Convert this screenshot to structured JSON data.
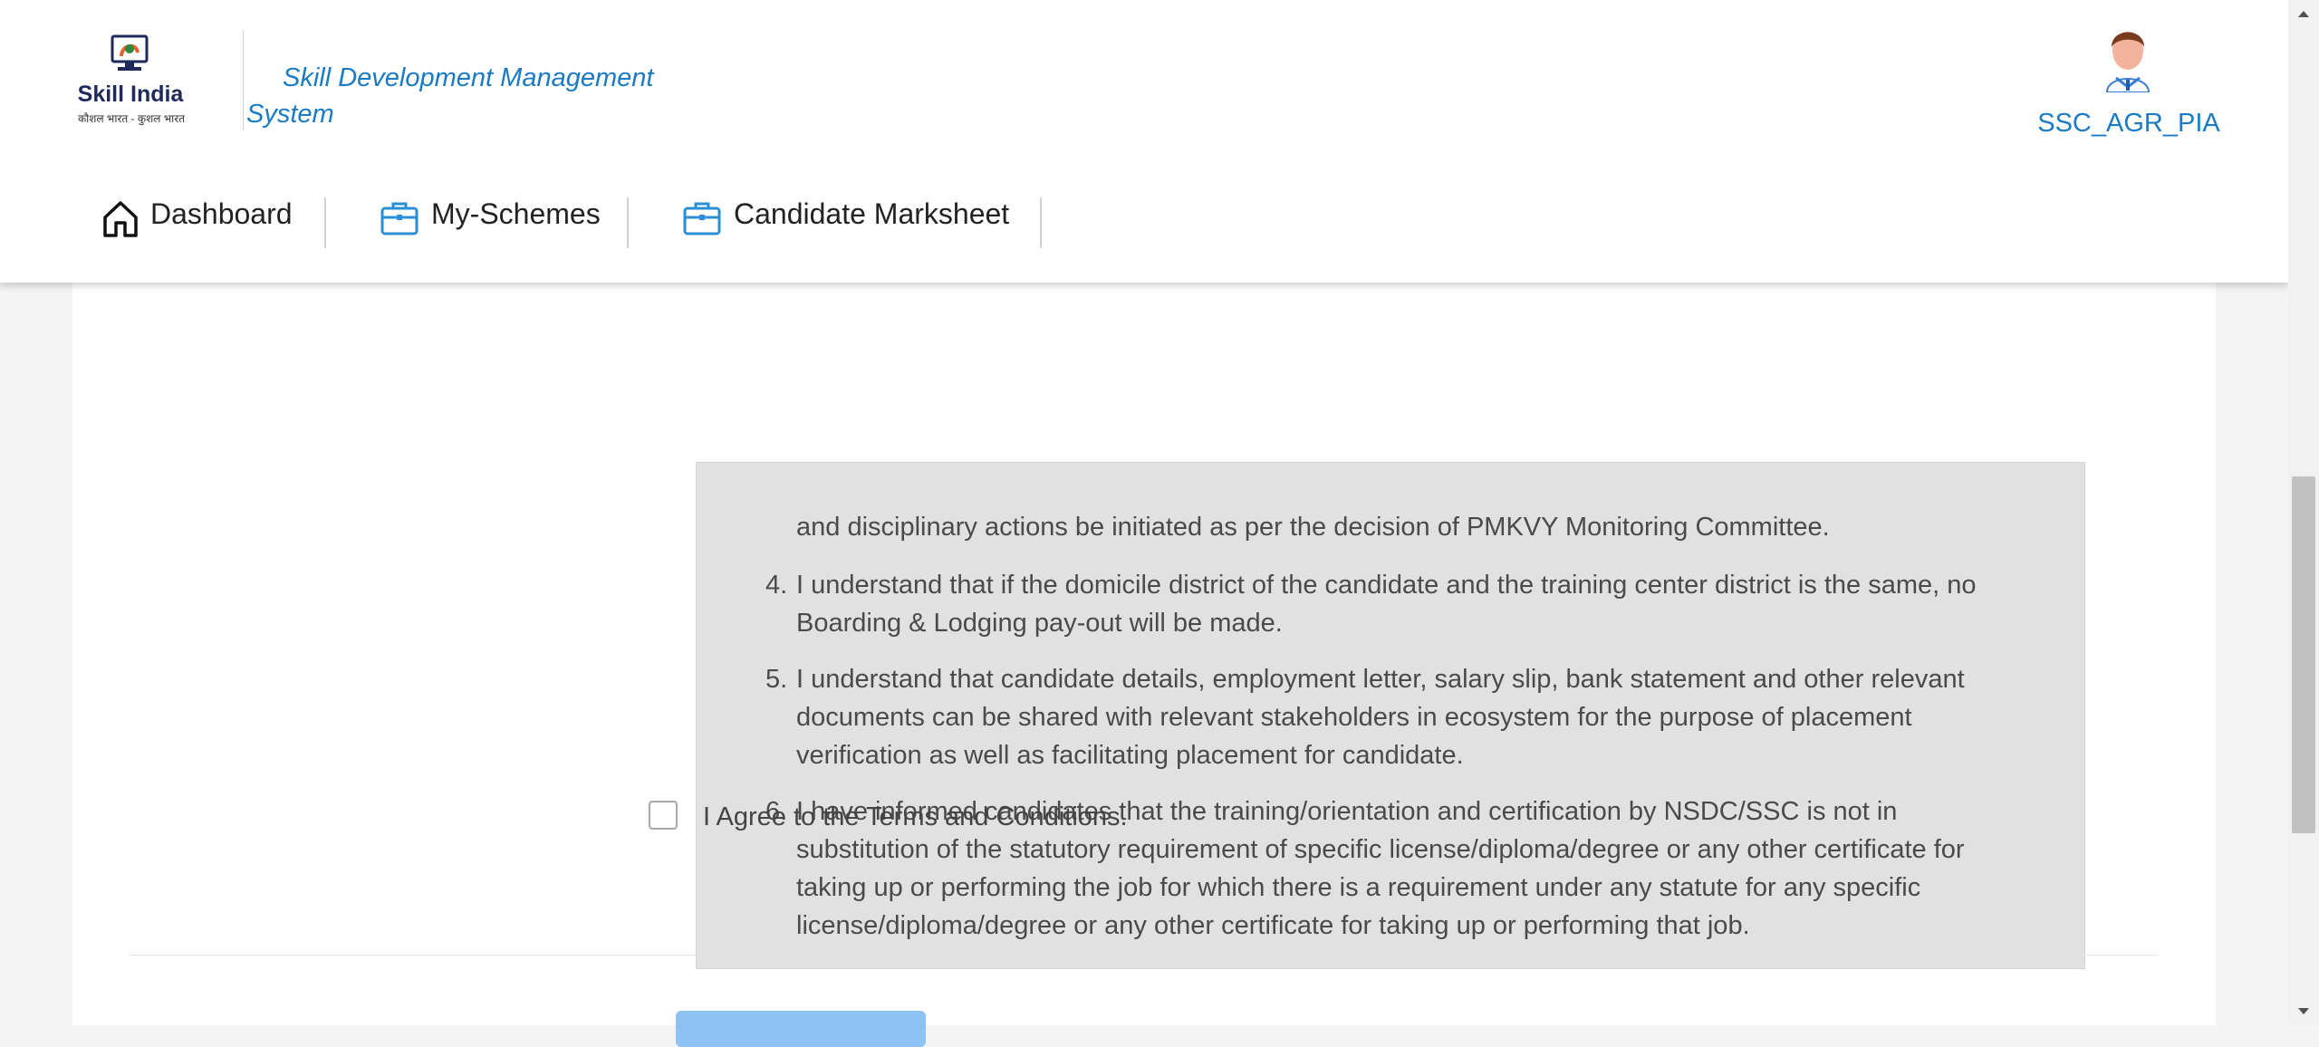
{
  "header": {
    "logo_brand": "Skill India",
    "logo_tagline": "कौशल भारत - कुशल भारत",
    "app_title": "Skill Development Management System",
    "user_name": "SSC_AGR_PIA",
    "nav": [
      {
        "label": "Dashboard",
        "icon": "home-icon"
      },
      {
        "label": "My-Schemes",
        "icon": "briefcase-icon"
      },
      {
        "label": "Candidate Marksheet",
        "icon": "briefcase-icon"
      }
    ]
  },
  "terms": {
    "partial_line": "and disciplinary actions be initiated as per the decision of PMKVY Monitoring Committee.",
    "items": [
      {
        "num": "4.",
        "lines": [
          "I understand that if the domicile district of the candidate and the training center district is the same, no",
          "Boarding & Lodging pay-out will be made."
        ]
      },
      {
        "num": "5.",
        "lines": [
          "I understand that candidate details, employment letter, salary slip, bank statement and other relevant",
          "documents can be shared with relevant stakeholders in ecosystem for the purpose of placement",
          "verification as well as facilitating placement for candidate."
        ]
      },
      {
        "num": "6.",
        "lines": [
          "I have informed candidates that the training/orientation and certification by NSDC/SSC is not in",
          "substitution of the statutory requirement of specific license/diploma/degree or any other certificate for",
          "taking up or performing the job for which there is a requirement under any statute for any specific",
          "license/diploma/degree or any other certificate for taking up or performing that job."
        ]
      }
    ],
    "agree_label": "I Agree to the Terms and Conditions.",
    "agree_checked": false
  },
  "colors": {
    "accent": "#1a7bc4",
    "terms_bg": "#e1e1e1",
    "submit_button": "#8ec2f2"
  }
}
